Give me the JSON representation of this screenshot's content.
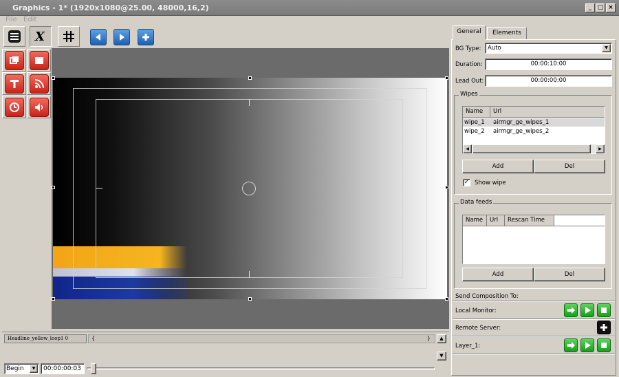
{
  "window": {
    "title": "Graphics - 1* (1920x1080@25.00, 48000,16,2)"
  },
  "menu": [
    {
      "label": "File"
    },
    {
      "label": "Edit"
    }
  ],
  "toolbar": {
    "buttons": [
      {
        "icon": "layers-icon"
      },
      {
        "icon": "script-x-icon"
      },
      {
        "icon": "grid-icon"
      },
      {
        "icon": "previous-icon"
      },
      {
        "icon": "play-icon"
      },
      {
        "icon": "add-icon"
      }
    ]
  },
  "tools": [
    {
      "icon": "window-icon"
    },
    {
      "icon": "rectangle-icon"
    },
    {
      "icon": "text-icon"
    },
    {
      "icon": "rss-icon"
    },
    {
      "icon": "clock-icon"
    },
    {
      "icon": "speaker-icon"
    }
  ],
  "timeline": {
    "track_label": "Headline_yellow_loop1 0",
    "track_marker": "{",
    "track_end_marker": "}",
    "mode": "Begin",
    "time": "00:00:00:03"
  },
  "panel": {
    "tabs": [
      {
        "label": "General"
      },
      {
        "label": "Elements"
      }
    ],
    "bg_type": {
      "label": "BG Type:",
      "value": "Auto"
    },
    "duration": {
      "label": "Duration:",
      "value": "00:00:10:00"
    },
    "lead_out": {
      "label": "Lead Out:",
      "value": "00:00:00:00"
    },
    "wipes": {
      "title": "Wipes",
      "columns": [
        "Name",
        "Url"
      ],
      "rows": [
        {
          "name": "wipe_1",
          "url": "airmgr_ge_wipes_1"
        },
        {
          "name": "wipe_2",
          "url": "airmgr_ge_wipes_2"
        }
      ],
      "add_label": "Add",
      "del_label": "Del",
      "show_wipe_label": "Show wipe",
      "show_wipe_checked": true
    },
    "data_feeds": {
      "title": "Data feeds",
      "columns": [
        "Name",
        "Url",
        "Rescan Time"
      ],
      "add_label": "Add",
      "del_label": "Del"
    },
    "send_to": {
      "label": "Send Composition To:",
      "local_monitor": "Local Monitor:",
      "remote_server": "Remote Server:",
      "layer": "Layer_1:"
    }
  },
  "colors": {
    "accent_blue": "#2a6fc4",
    "accent_red": "#d6362a",
    "accent_green": "#22b022",
    "strip_orange": "#f2a516",
    "strip_blue": "#1c3aa0"
  }
}
